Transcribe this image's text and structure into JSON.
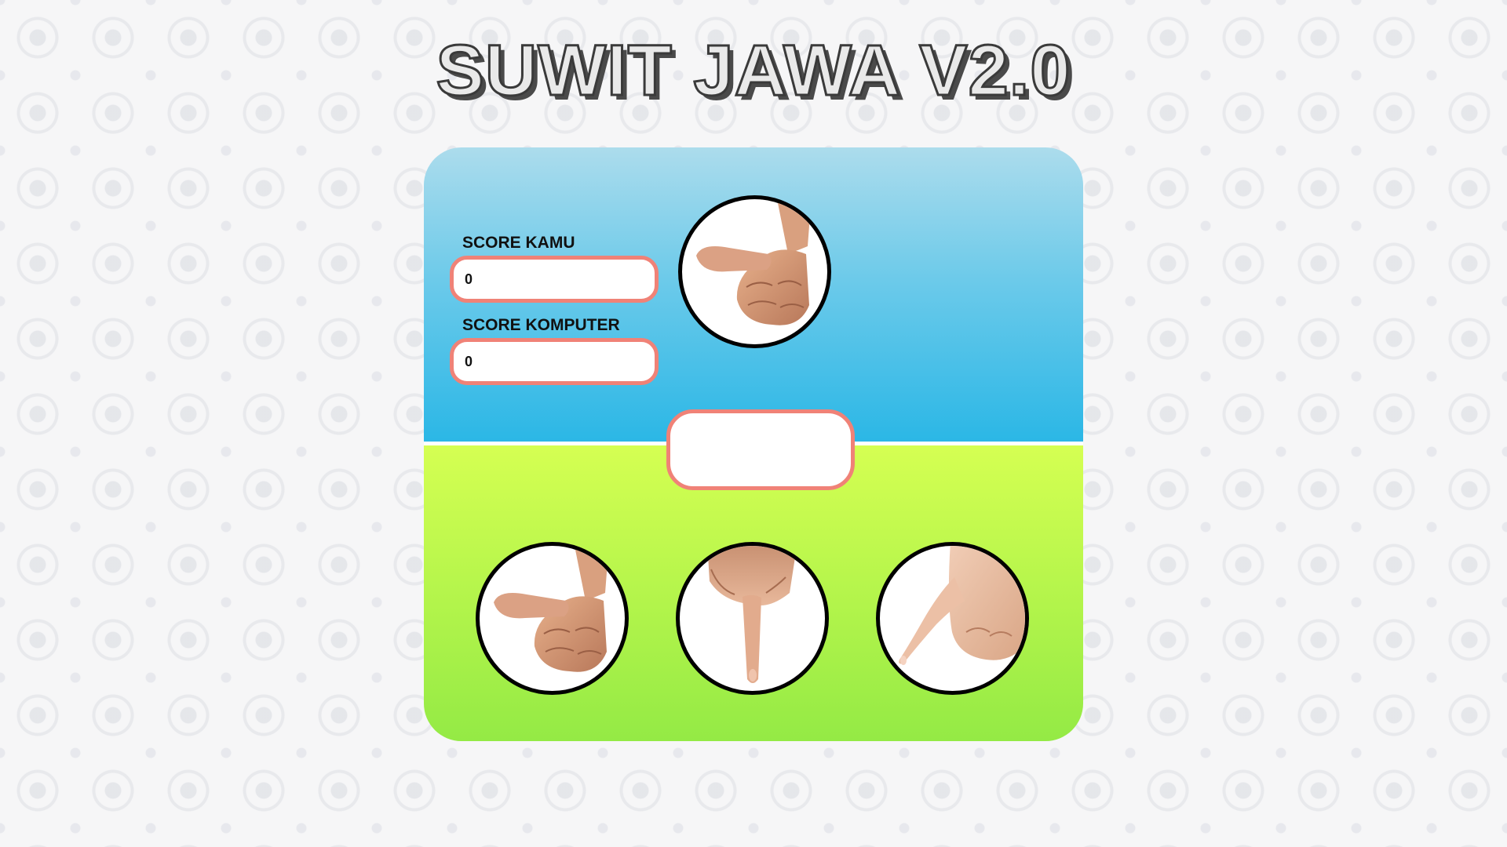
{
  "title": "SUWIT JAWA V2.0",
  "scores": {
    "player_label": "SCORE KAMU",
    "player_value": "0",
    "computer_label": "SCORE KOMPUTER",
    "computer_value": "0"
  },
  "result_text": "",
  "computer_choice_icon": "thumb-hand-icon",
  "player_choices": [
    {
      "icon": "thumb-hand-icon"
    },
    {
      "icon": "index-finger-hand-icon"
    },
    {
      "icon": "pinky-finger-hand-icon"
    }
  ],
  "colors": {
    "top_panel": "#2bb7e6",
    "bottom_panel": "#94ea45",
    "field_border": "#f08277"
  }
}
